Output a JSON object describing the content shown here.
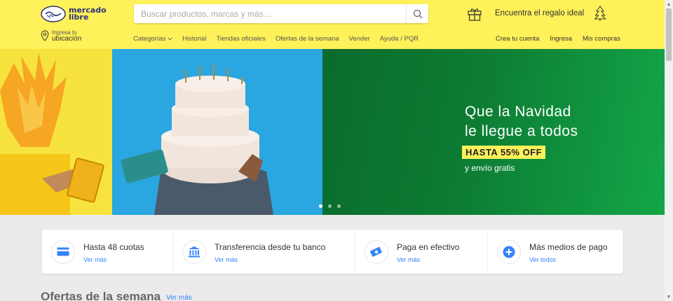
{
  "logo": {
    "line1": "mercado",
    "line2": "libre"
  },
  "location": {
    "line1": "Ingresa tu",
    "line2": "ubicación"
  },
  "search": {
    "placeholder": "Buscar productos, marcas y más…",
    "value": ""
  },
  "nav": {
    "categories": "Categorías",
    "history": "Historial",
    "stores": "Tiendas oficiales",
    "deals": "Ofertas de la semana",
    "sell": "Vender",
    "help": "Ayuda / PQR"
  },
  "promo": {
    "text": "Encuentra el regalo ideal"
  },
  "user_nav": {
    "create": "Crea tu cuenta",
    "login": "Ingresa",
    "purchases": "Mis compras"
  },
  "hero": {
    "title_line1": "Que la Navidad",
    "title_line2": "le llegue a todos",
    "badge": "HASTA 55% OFF",
    "subtitle": "y envío gratis",
    "slide_count": 3,
    "active_slide": 1
  },
  "payments": [
    {
      "title": "Hasta 48 cuotas",
      "link": "Ver más",
      "icon": "credit-card-icon"
    },
    {
      "title": "Transferencia desde tu banco",
      "link": "Ver más",
      "icon": "bank-icon"
    },
    {
      "title": "Paga en efectivo",
      "link": "Ver más",
      "icon": "cash-icon"
    },
    {
      "title": "Más medios de pago",
      "link": "Ver todos",
      "icon": "plus-circle-icon"
    }
  ],
  "section": {
    "title": "Ofertas de la semana",
    "link": "Ver más"
  },
  "colors": {
    "header_bg": "#fff159",
    "brand_blue": "#2d3277",
    "link_blue": "#3483fa",
    "hero_green": "#0d7d34"
  }
}
